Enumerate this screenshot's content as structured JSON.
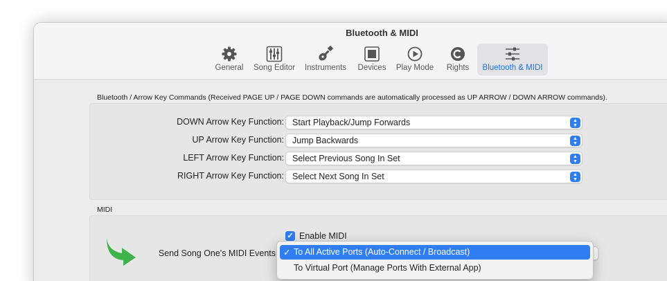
{
  "window": {
    "title": "Bluetooth & MIDI"
  },
  "toolbar": {
    "items": [
      {
        "label": "General",
        "icon": "gear-icon"
      },
      {
        "label": "Song Editor",
        "icon": "sliders-icon"
      },
      {
        "label": "Instruments",
        "icon": "guitar-icon"
      },
      {
        "label": "Devices",
        "icon": "devices-icon"
      },
      {
        "label": "Play Mode",
        "icon": "play-circle-icon"
      },
      {
        "label": "Rights",
        "icon": "copyright-icon"
      },
      {
        "label": "Bluetooth & MIDI",
        "icon": "bluetooth-midi-icon"
      }
    ],
    "active": "Bluetooth & MIDI"
  },
  "bluetooth": {
    "caption": "Bluetooth / Arrow Key Commands (Received PAGE UP / PAGE DOWN commands are automatically processed as UP ARROW / DOWN ARROW commands).",
    "rows": [
      {
        "label": "DOWN Arrow Key Function:",
        "value": "Start Playback/Jump Forwards"
      },
      {
        "label": "UP Arrow Key Function:",
        "value": "Jump Backwards"
      },
      {
        "label": "LEFT Arrow Key Function:",
        "value": "Select Previous Song In Set"
      },
      {
        "label": "RIGHT Arrow Key Function:",
        "value": "Select Next Song In Set"
      }
    ]
  },
  "midi": {
    "caption": "MIDI",
    "enable_label": "Enable MIDI",
    "enable_checked": true,
    "send_label": "Send Song One's MIDI Events",
    "menu_options": [
      "To All Active Ports (Auto-Connect / Broadcast)",
      "To Virtual Port (Manage Ports With External App)"
    ],
    "selected_option": "To All Active Ports (Auto-Connect / Broadcast)",
    "check_glyph": "✓"
  },
  "colors": {
    "accent": "#2f7df0",
    "highlight_arrow": "#3fb34a"
  }
}
